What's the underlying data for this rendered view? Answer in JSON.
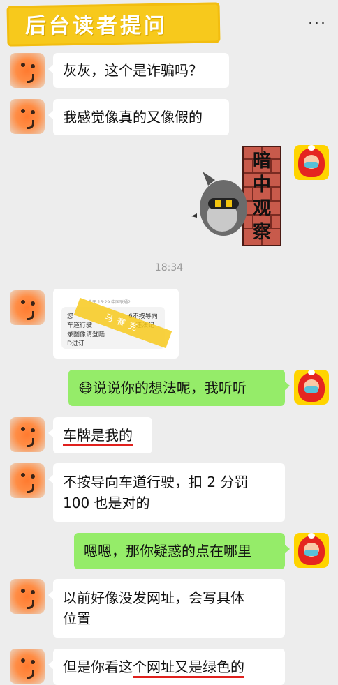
{
  "header": {
    "title": "后台读者提问",
    "more_glyph": "···"
  },
  "messages": [
    {
      "side": "left",
      "text": "灰灰，这个是诈骗吗？"
    },
    {
      "side": "left",
      "text": "我感觉像真的又像假的"
    },
    {
      "side": "right",
      "sticker_text": "暗中观察"
    },
    {
      "time": "18:34"
    },
    {
      "side": "left",
      "image": {
        "sms_header": "今天 15:29 中国联通2 ",
        "lines": [
          "您",
          "车道行驶",
          "录图像请登陆",
          "D进订"
        ],
        "line_right": [
          "6不按导向",
          "违法记"
        ],
        "watermark": "马赛克"
      }
    },
    {
      "side": "right",
      "emoji": "😷",
      "text": "说说你的想法呢，我听听"
    },
    {
      "side": "left",
      "text": "车牌是我的"
    },
    {
      "side": "left",
      "lines": [
        "不按导向车道行驶，扣 2 分罚",
        "100 也是对的"
      ]
    },
    {
      "side": "right",
      "text": "嗯嗯，那你疑惑的点在哪里"
    },
    {
      "side": "left",
      "lines": [
        "以前好像没发网址，会写具体",
        "位置"
      ]
    },
    {
      "side": "left",
      "text_parts": [
        "但是你看这",
        "个网址",
        "又是绿色的"
      ]
    }
  ],
  "colors": {
    "background": "#ededed",
    "bubble_left": "#ffffff",
    "bubble_right": "#95ec69",
    "title_banner": "#f7c91c",
    "underline": "#e0201d"
  }
}
